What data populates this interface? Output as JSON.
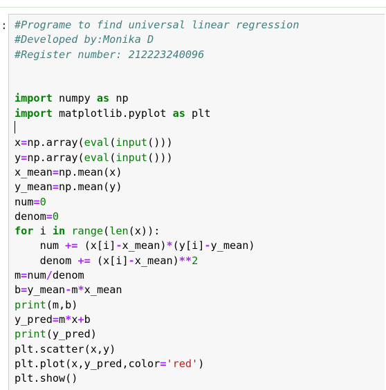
{
  "prompt_marker": ":",
  "code_lines": [
    [
      {
        "t": "cm",
        "v": "#Programe to find universal linear regression"
      }
    ],
    [
      {
        "t": "cm",
        "v": "#Developed by:Monika D"
      }
    ],
    [
      {
        "t": "cm",
        "v": "#Register number: 212223240096"
      }
    ],
    [],
    [],
    [
      {
        "t": "kw",
        "v": "import"
      },
      {
        "t": "nm",
        "v": " numpy "
      },
      {
        "t": "kw",
        "v": "as"
      },
      {
        "t": "nm",
        "v": " np"
      }
    ],
    [
      {
        "t": "kw",
        "v": "import"
      },
      {
        "t": "nm",
        "v": " matplotlib.pyplot "
      },
      {
        "t": "kw",
        "v": "as"
      },
      {
        "t": "nm",
        "v": " plt"
      }
    ],
    [
      {
        "t": "cursor",
        "v": ""
      }
    ],
    [
      {
        "t": "nm",
        "v": "x"
      },
      {
        "t": "op",
        "v": "="
      },
      {
        "t": "nm",
        "v": "np.array("
      },
      {
        "t": "bi",
        "v": "eval"
      },
      {
        "t": "pun",
        "v": "("
      },
      {
        "t": "bi",
        "v": "input"
      },
      {
        "t": "pun",
        "v": "()))"
      }
    ],
    [
      {
        "t": "nm",
        "v": "y"
      },
      {
        "t": "op",
        "v": "="
      },
      {
        "t": "nm",
        "v": "np.array("
      },
      {
        "t": "bi",
        "v": "eval"
      },
      {
        "t": "pun",
        "v": "("
      },
      {
        "t": "bi",
        "v": "input"
      },
      {
        "t": "pun",
        "v": "()))"
      }
    ],
    [
      {
        "t": "nm",
        "v": "x_mean"
      },
      {
        "t": "op",
        "v": "="
      },
      {
        "t": "nm",
        "v": "np.mean(x)"
      }
    ],
    [
      {
        "t": "nm",
        "v": "y_mean"
      },
      {
        "t": "op",
        "v": "="
      },
      {
        "t": "nm",
        "v": "np.mean(y)"
      }
    ],
    [
      {
        "t": "nm",
        "v": "num"
      },
      {
        "t": "op",
        "v": "="
      },
      {
        "t": "num",
        "v": "0"
      }
    ],
    [
      {
        "t": "nm",
        "v": "denom"
      },
      {
        "t": "op",
        "v": "="
      },
      {
        "t": "num",
        "v": "0"
      }
    ],
    [
      {
        "t": "kw",
        "v": "for"
      },
      {
        "t": "nm",
        "v": " i "
      },
      {
        "t": "kw",
        "v": "in"
      },
      {
        "t": "nm",
        "v": " "
      },
      {
        "t": "bi",
        "v": "range"
      },
      {
        "t": "pun",
        "v": "("
      },
      {
        "t": "bi",
        "v": "len"
      },
      {
        "t": "pun",
        "v": "(x)):"
      }
    ],
    [
      {
        "t": "nm",
        "v": "    num "
      },
      {
        "t": "op",
        "v": "+="
      },
      {
        "t": "nm",
        "v": " (x[i]"
      },
      {
        "t": "op",
        "v": "-"
      },
      {
        "t": "nm",
        "v": "x_mean)"
      },
      {
        "t": "op",
        "v": "*"
      },
      {
        "t": "nm",
        "v": "(y[i]"
      },
      {
        "t": "op",
        "v": "-"
      },
      {
        "t": "nm",
        "v": "y_mean)"
      }
    ],
    [
      {
        "t": "nm",
        "v": "    denom "
      },
      {
        "t": "op",
        "v": "+="
      },
      {
        "t": "nm",
        "v": " (x[i]"
      },
      {
        "t": "op",
        "v": "-"
      },
      {
        "t": "nm",
        "v": "x_mean)"
      },
      {
        "t": "op",
        "v": "**"
      },
      {
        "t": "num",
        "v": "2"
      }
    ],
    [
      {
        "t": "nm",
        "v": "m"
      },
      {
        "t": "op",
        "v": "="
      },
      {
        "t": "nm",
        "v": "num"
      },
      {
        "t": "op",
        "v": "/"
      },
      {
        "t": "nm",
        "v": "denom"
      }
    ],
    [
      {
        "t": "nm",
        "v": "b"
      },
      {
        "t": "op",
        "v": "="
      },
      {
        "t": "nm",
        "v": "y_mean"
      },
      {
        "t": "op",
        "v": "-"
      },
      {
        "t": "nm",
        "v": "m"
      },
      {
        "t": "op",
        "v": "*"
      },
      {
        "t": "nm",
        "v": "x_mean"
      }
    ],
    [
      {
        "t": "bi",
        "v": "print"
      },
      {
        "t": "nm",
        "v": "(m,b)"
      }
    ],
    [
      {
        "t": "nm",
        "v": "y_pred"
      },
      {
        "t": "op",
        "v": "="
      },
      {
        "t": "nm",
        "v": "m"
      },
      {
        "t": "op",
        "v": "*"
      },
      {
        "t": "nm",
        "v": "x"
      },
      {
        "t": "op",
        "v": "+"
      },
      {
        "t": "nm",
        "v": "b"
      }
    ],
    [
      {
        "t": "bi",
        "v": "print"
      },
      {
        "t": "nm",
        "v": "(y_pred)"
      }
    ],
    [
      {
        "t": "nm",
        "v": "plt.scatter(x,y)"
      }
    ],
    [
      {
        "t": "nm",
        "v": "plt.plot(x,y_pred,color"
      },
      {
        "t": "op",
        "v": "="
      },
      {
        "t": "str",
        "v": "'red'"
      },
      {
        "t": "nm",
        "v": ")"
      }
    ],
    [
      {
        "t": "nm",
        "v": "plt.show()"
      }
    ]
  ]
}
